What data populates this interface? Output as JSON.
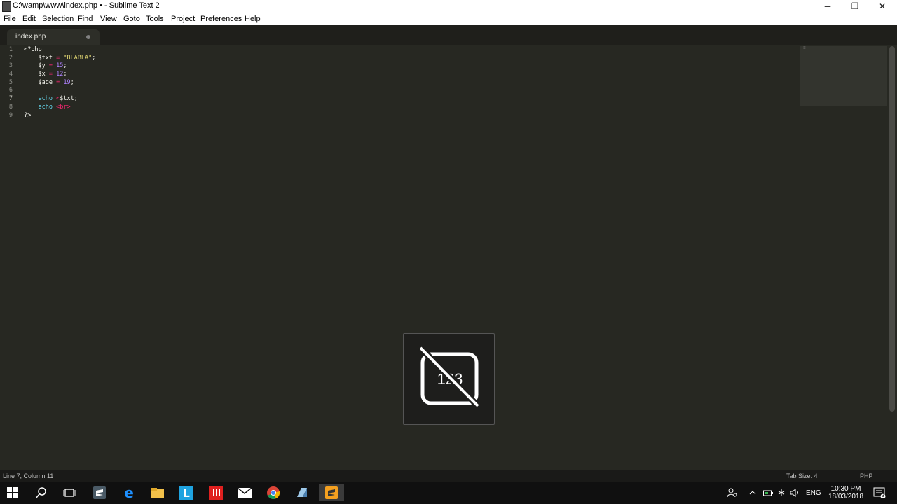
{
  "window": {
    "title": "C:\\wamp\\www\\index.php • - Sublime Text 2",
    "minimize": "─",
    "restore": "❐",
    "close": "✕"
  },
  "menu": [
    {
      "label": "File"
    },
    {
      "label": "Edit"
    },
    {
      "label": "Selection"
    },
    {
      "label": "Find"
    },
    {
      "label": "View"
    },
    {
      "label": "Goto"
    },
    {
      "label": "Tools"
    },
    {
      "label": "Project"
    },
    {
      "label": "Preferences"
    },
    {
      "label": "Help"
    }
  ],
  "tab": {
    "name": "index.php"
  },
  "editor": {
    "line_numbers": [
      "1",
      "2",
      "3",
      "4",
      "5",
      "6",
      "7",
      "8",
      "9"
    ],
    "lines": [
      [
        {
          "t": "<?php",
          "c": "plain"
        }
      ],
      [
        {
          "t": "    $txt ",
          "c": "plain"
        },
        {
          "t": "=",
          "c": "kw"
        },
        {
          "t": " ",
          "c": "plain"
        },
        {
          "t": "\"BLABLA\"",
          "c": "str"
        },
        {
          "t": ";",
          "c": "plain"
        }
      ],
      [
        {
          "t": "    $y ",
          "c": "plain"
        },
        {
          "t": "=",
          "c": "kw"
        },
        {
          "t": " ",
          "c": "plain"
        },
        {
          "t": "15",
          "c": "num"
        },
        {
          "t": ";",
          "c": "plain"
        }
      ],
      [
        {
          "t": "    $x ",
          "c": "plain"
        },
        {
          "t": "=",
          "c": "kw"
        },
        {
          "t": " ",
          "c": "plain"
        },
        {
          "t": "12",
          "c": "num"
        },
        {
          "t": ";",
          "c": "plain"
        }
      ],
      [
        {
          "t": "    $age ",
          "c": "plain"
        },
        {
          "t": "=",
          "c": "kw"
        },
        {
          "t": " ",
          "c": "plain"
        },
        {
          "t": "19",
          "c": "num"
        },
        {
          "t": ";",
          "c": "plain"
        }
      ],
      [
        {
          "t": "",
          "c": "plain"
        }
      ],
      [
        {
          "t": "    ",
          "c": "plain"
        },
        {
          "t": "echo",
          "c": "fn"
        },
        {
          "t": " ",
          "c": "plain"
        },
        {
          "t": "<",
          "c": "kw"
        },
        {
          "t": "$txt;",
          "c": "plain"
        }
      ],
      [
        {
          "t": "    ",
          "c": "plain"
        },
        {
          "t": "echo",
          "c": "fn"
        },
        {
          "t": " ",
          "c": "plain"
        },
        {
          "t": "<br>",
          "c": "kw"
        }
      ],
      [
        {
          "t": "?>",
          "c": "plain"
        }
      ]
    ]
  },
  "osd": {
    "number_text": "123"
  },
  "status": {
    "position": "Line 7, Column 11",
    "tab_size": "Tab Size: 4",
    "syntax": "PHP"
  },
  "taskbar": {
    "apps": [
      "windows-start",
      "search",
      "task-view",
      "sublime-text",
      "edge",
      "file-explorer",
      "app-l",
      "app-red",
      "mail",
      "chrome",
      "app-blue",
      "sublime-text-active"
    ],
    "lang": "ENG",
    "time": "10:30 PM",
    "date": "18/03/2018",
    "notifications": "3"
  },
  "colors": {
    "background": "#272822",
    "keyword": "#f92672",
    "string": "#e6db74",
    "number": "#ae81ff",
    "function": "#66d9ef"
  }
}
